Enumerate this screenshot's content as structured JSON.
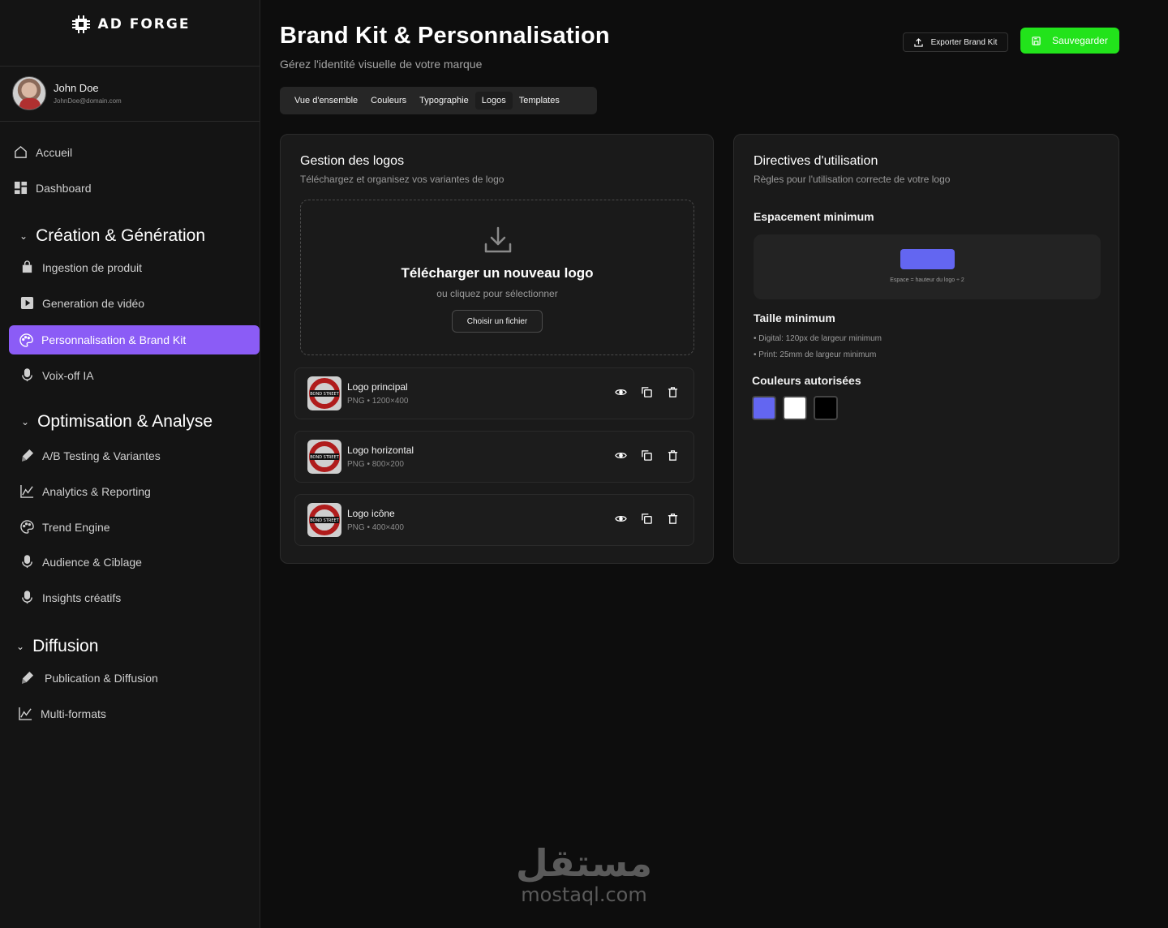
{
  "app": {
    "brand": "AD FORGE"
  },
  "user": {
    "name": "John Doe",
    "email": "JohnDoe@domain.com"
  },
  "nav": {
    "top": [
      {
        "label": "Accueil",
        "icon": "home-icon"
      },
      {
        "label": "Dashboard",
        "icon": "dashboard-icon"
      }
    ],
    "sections": [
      {
        "title": "Création & Génération",
        "items": [
          {
            "label": "Ingestion de produit",
            "icon": "bag-icon"
          },
          {
            "label": "Generation de vidéo",
            "icon": "play-icon"
          },
          {
            "label": "Personnalisation & Brand Kit",
            "icon": "palette-icon",
            "active": true
          },
          {
            "label": "Voix-off IA",
            "icon": "mic-icon"
          }
        ]
      },
      {
        "title": "Optimisation & Analyse",
        "items": [
          {
            "label": "A/B Testing & Variantes",
            "icon": "brush-icon"
          },
          {
            "label": "Analytics & Reporting",
            "icon": "chart-icon"
          },
          {
            "label": "Trend Engine",
            "icon": "palette-icon"
          },
          {
            "label": "Audience & Ciblage",
            "icon": "mic-icon"
          },
          {
            "label": "Insights créatifs",
            "icon": "mic-icon"
          }
        ]
      },
      {
        "title": "Diffusion",
        "items": [
          {
            "label": "Publication & Diffusion",
            "icon": "brush-icon"
          },
          {
            "label": "Multi-formats",
            "icon": "chart-icon"
          }
        ]
      }
    ]
  },
  "header": {
    "title": "Brand Kit & Personnalisation",
    "subtitle": "Gérez l'identité visuelle de votre marque",
    "export_label": "Exporter Brand Kit",
    "save_label": "Sauvegarder"
  },
  "tabs": [
    {
      "label": "Vue d'ensemble"
    },
    {
      "label": "Couleurs"
    },
    {
      "label": "Typographie"
    },
    {
      "label": "Logos",
      "active": true
    },
    {
      "label": "Templates"
    }
  ],
  "logos_card": {
    "title": "Gestion des logos",
    "subtitle": "Téléchargez et organisez vos variantes de logo",
    "upload_title": "Télécharger un nouveau logo",
    "upload_sub": "ou cliquez pour sélectionner",
    "upload_button": "Choisir un fichier",
    "thumb_text": "BOND STREET",
    "items": [
      {
        "name": "Logo principal",
        "meta": "PNG • 1200×400"
      },
      {
        "name": "Logo horizontal",
        "meta": "PNG • 800×200"
      },
      {
        "name": "Logo icône",
        "meta": "PNG • 400×400"
      }
    ]
  },
  "guidelines_card": {
    "title": "Directives d'utilisation",
    "subtitle": "Règles pour l'utilisation correcte de votre logo",
    "spacing_title": "Espacement minimum",
    "spacing_caption": "Espace = hauteur du logo ÷ 2",
    "size_title": "Taille minimum",
    "size_rules": [
      "• Digital: 120px de largeur minimum",
      "• Print: 25mm de largeur minimum"
    ],
    "colors_title": "Couleurs autorisées",
    "colors": [
      "#6366f1",
      "#ffffff",
      "#000000"
    ]
  },
  "watermark": {
    "arabic": "مستقل",
    "latin": "mostaql.com"
  }
}
